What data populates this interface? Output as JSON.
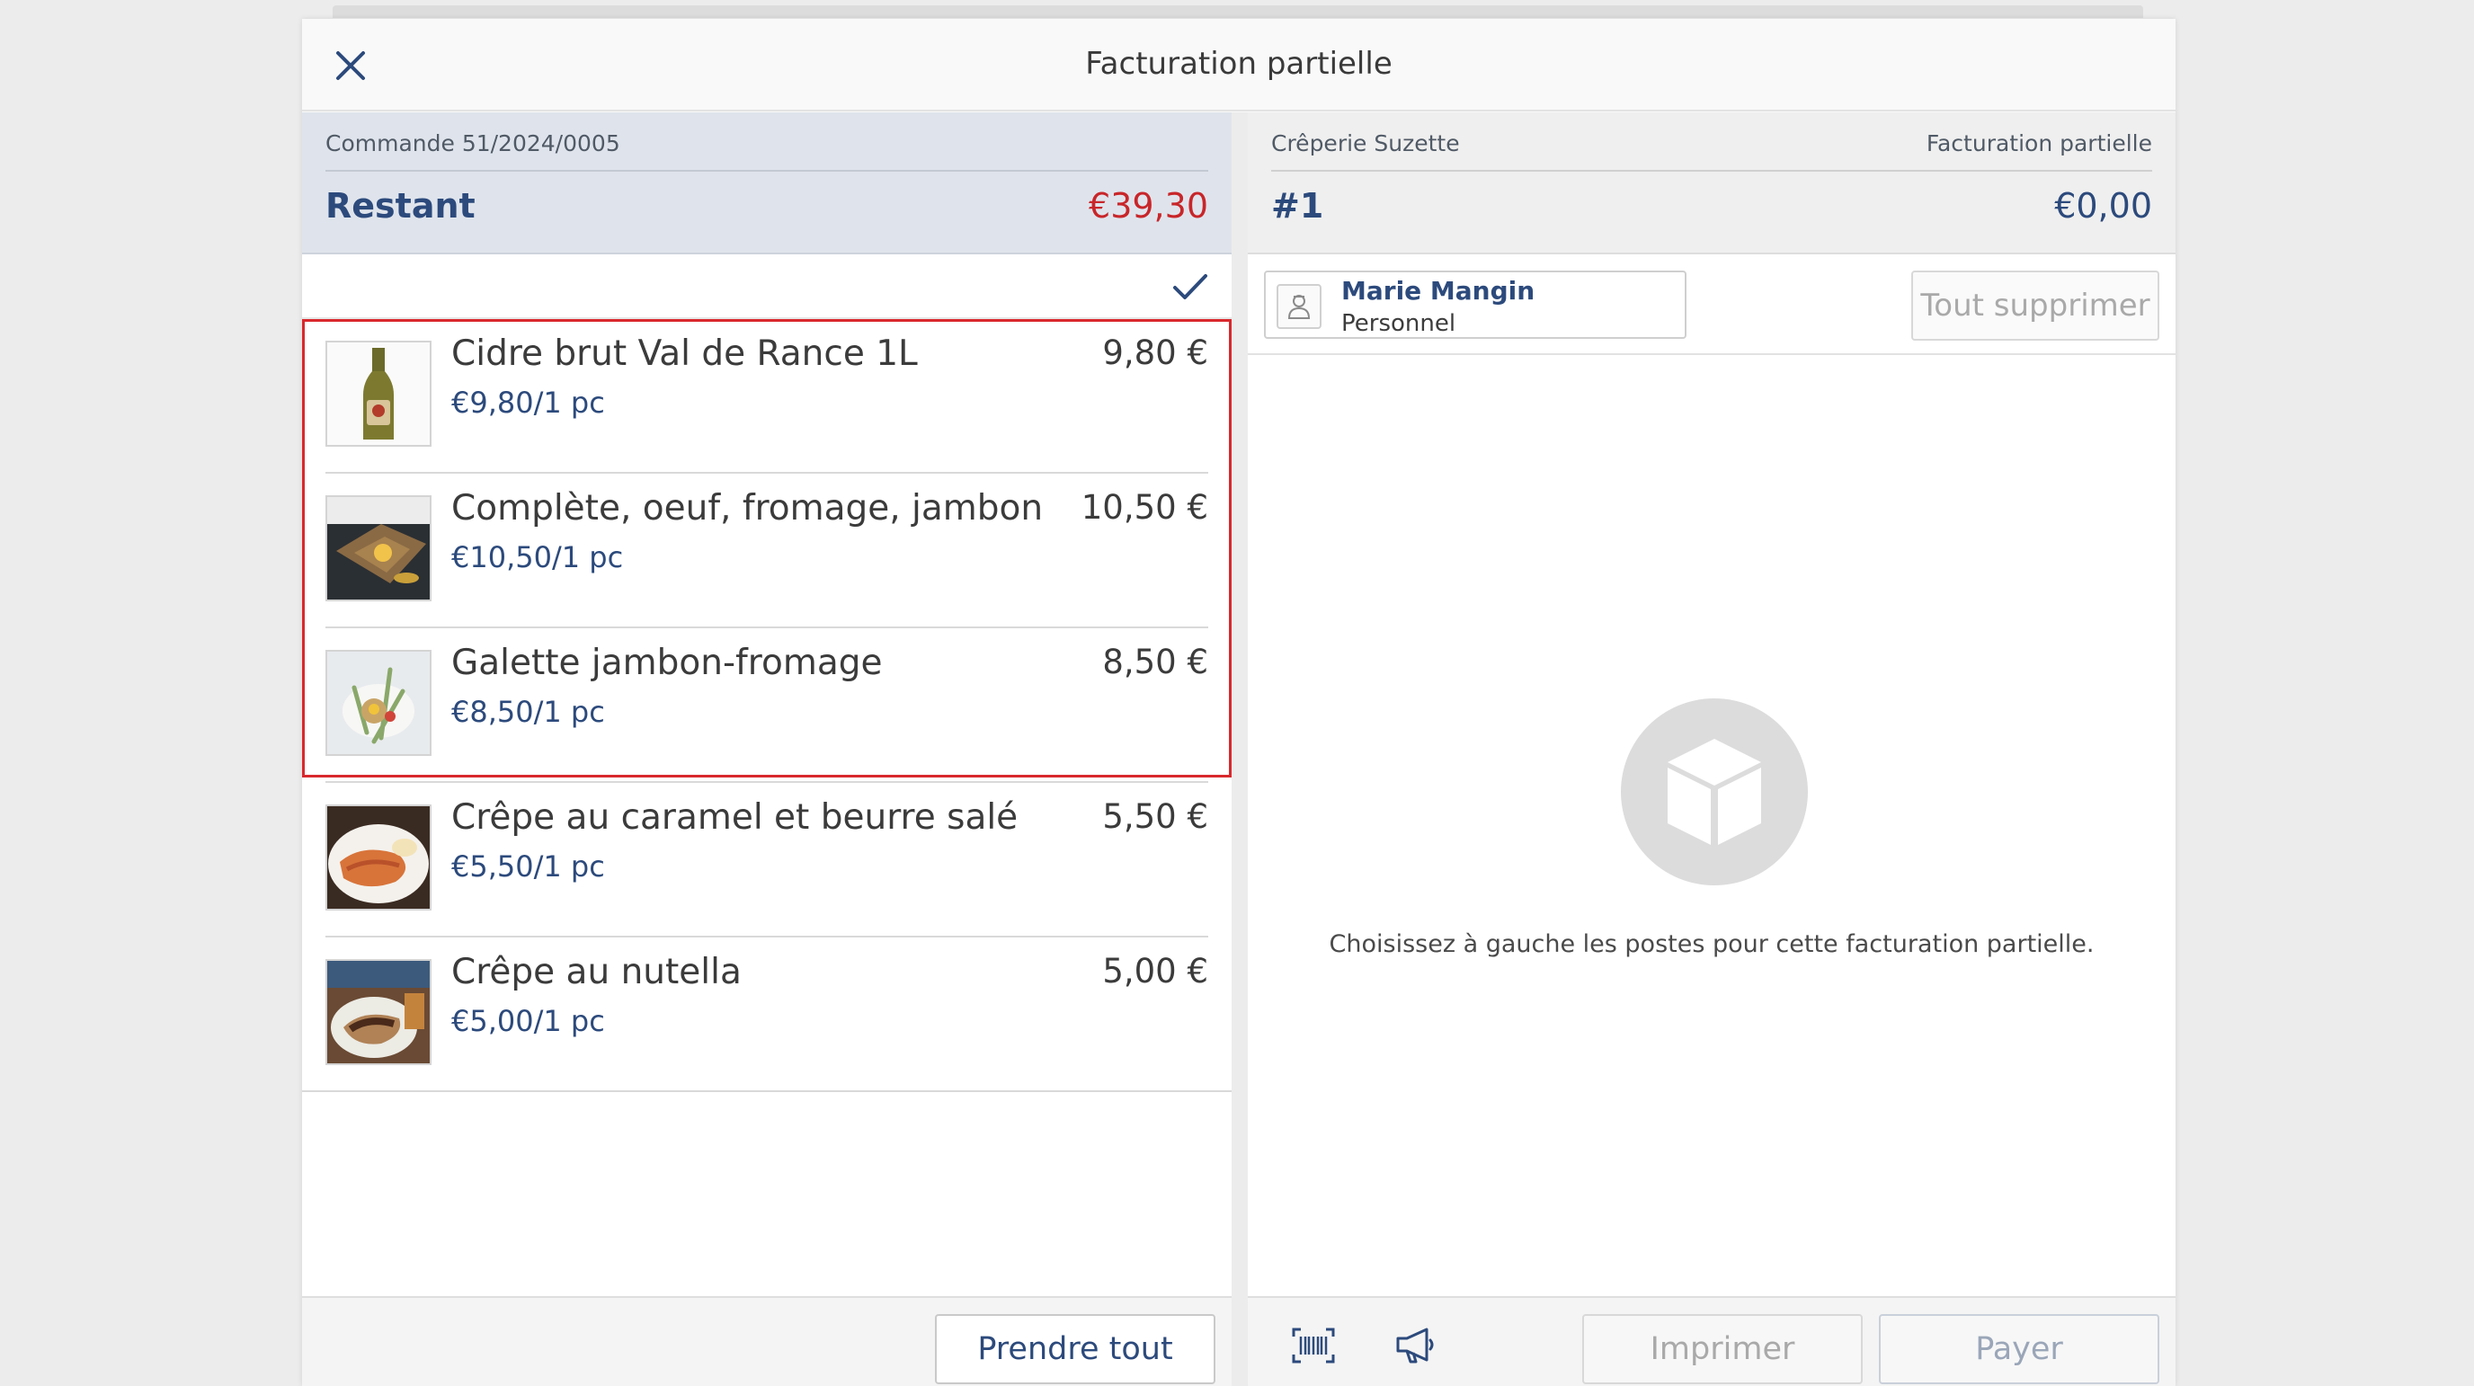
{
  "modal": {
    "title": "Facturation partielle"
  },
  "left": {
    "order_ref": "Commande 51/2024/0005",
    "remaining_label": "Restant",
    "remaining_value": "€39,30",
    "items": [
      {
        "name": "Cidre brut Val de Rance 1L",
        "unit": "€9,80/1 pc",
        "price": "9,80 €",
        "icon": "cider-bottle-photo"
      },
      {
        "name": "Complète, oeuf, fromage, jambon",
        "unit": "€10,50/1 pc",
        "price": "10,50 €",
        "icon": "galette-photo"
      },
      {
        "name": "Galette jambon-fromage",
        "unit": "€8,50/1 pc",
        "price": "8,50 €",
        "icon": "galette-plate-photo"
      },
      {
        "name": "Crêpe au caramel et beurre salé",
        "unit": "€5,50/1 pc",
        "price": "5,50 €",
        "icon": "caramel-crepe-photo"
      },
      {
        "name": "Crêpe au nutella",
        "unit": "€5,00/1 pc",
        "price": "5,00 €",
        "icon": "nutella-crepe-photo"
      }
    ],
    "take_all_label": "Prendre tout"
  },
  "right": {
    "shop_name": "Crêperie Suzette",
    "billing_kind": "Facturation partielle",
    "bill_number": "#1",
    "bill_total": "€0,00",
    "staff": {
      "name": "Marie Mangin",
      "role": "Personnel"
    },
    "delete_all_label": "Tout supprimer",
    "empty_text": "Choisissez à gauche les postes pour cette facturation partielle.",
    "print_label": "Imprimer",
    "pay_label": "Payer"
  },
  "colors": {
    "accent": "#2c4a7c",
    "remaining": "#c8262a",
    "selection": "#d9282d"
  }
}
